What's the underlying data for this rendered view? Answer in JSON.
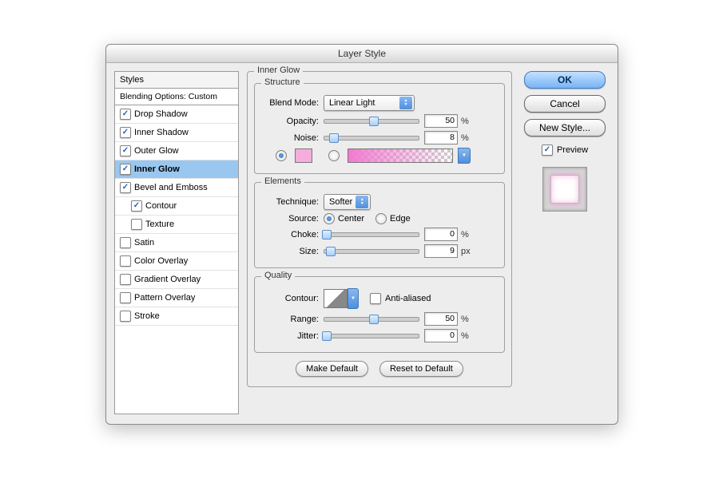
{
  "title": "Layer Style",
  "sidebar": {
    "header": "Styles",
    "subheader": "Blending Options: Custom",
    "items": [
      {
        "label": "Drop Shadow",
        "checked": true,
        "indent": false
      },
      {
        "label": "Inner Shadow",
        "checked": true,
        "indent": false
      },
      {
        "label": "Outer Glow",
        "checked": true,
        "indent": false
      },
      {
        "label": "Inner Glow",
        "checked": true,
        "indent": false,
        "selected": true
      },
      {
        "label": "Bevel and Emboss",
        "checked": true,
        "indent": false
      },
      {
        "label": "Contour",
        "checked": true,
        "indent": true
      },
      {
        "label": "Texture",
        "checked": false,
        "indent": true
      },
      {
        "label": "Satin",
        "checked": false,
        "indent": false
      },
      {
        "label": "Color Overlay",
        "checked": false,
        "indent": false
      },
      {
        "label": "Gradient Overlay",
        "checked": false,
        "indent": false
      },
      {
        "label": "Pattern Overlay",
        "checked": false,
        "indent": false
      },
      {
        "label": "Stroke",
        "checked": false,
        "indent": false
      }
    ]
  },
  "panel": {
    "title": "Inner Glow",
    "structure": {
      "legend": "Structure",
      "blend_mode_label": "Blend Mode:",
      "blend_mode_value": "Linear Light",
      "opacity_label": "Opacity:",
      "opacity_value": "50",
      "opacity_unit": "%",
      "noise_label": "Noise:",
      "noise_value": "8",
      "noise_unit": "%"
    },
    "elements": {
      "legend": "Elements",
      "technique_label": "Technique:",
      "technique_value": "Softer",
      "source_label": "Source:",
      "source_center": "Center",
      "source_edge": "Edge",
      "choke_label": "Choke:",
      "choke_value": "0",
      "choke_unit": "%",
      "size_label": "Size:",
      "size_value": "9",
      "size_unit": "px"
    },
    "quality": {
      "legend": "Quality",
      "contour_label": "Contour:",
      "antialias_label": "Anti-aliased",
      "range_label": "Range:",
      "range_value": "50",
      "range_unit": "%",
      "jitter_label": "Jitter:",
      "jitter_value": "0",
      "jitter_unit": "%"
    },
    "buttons": {
      "make_default": "Make Default",
      "reset_default": "Reset to Default"
    }
  },
  "right": {
    "ok": "OK",
    "cancel": "Cancel",
    "new_style": "New Style...",
    "preview": "Preview"
  }
}
